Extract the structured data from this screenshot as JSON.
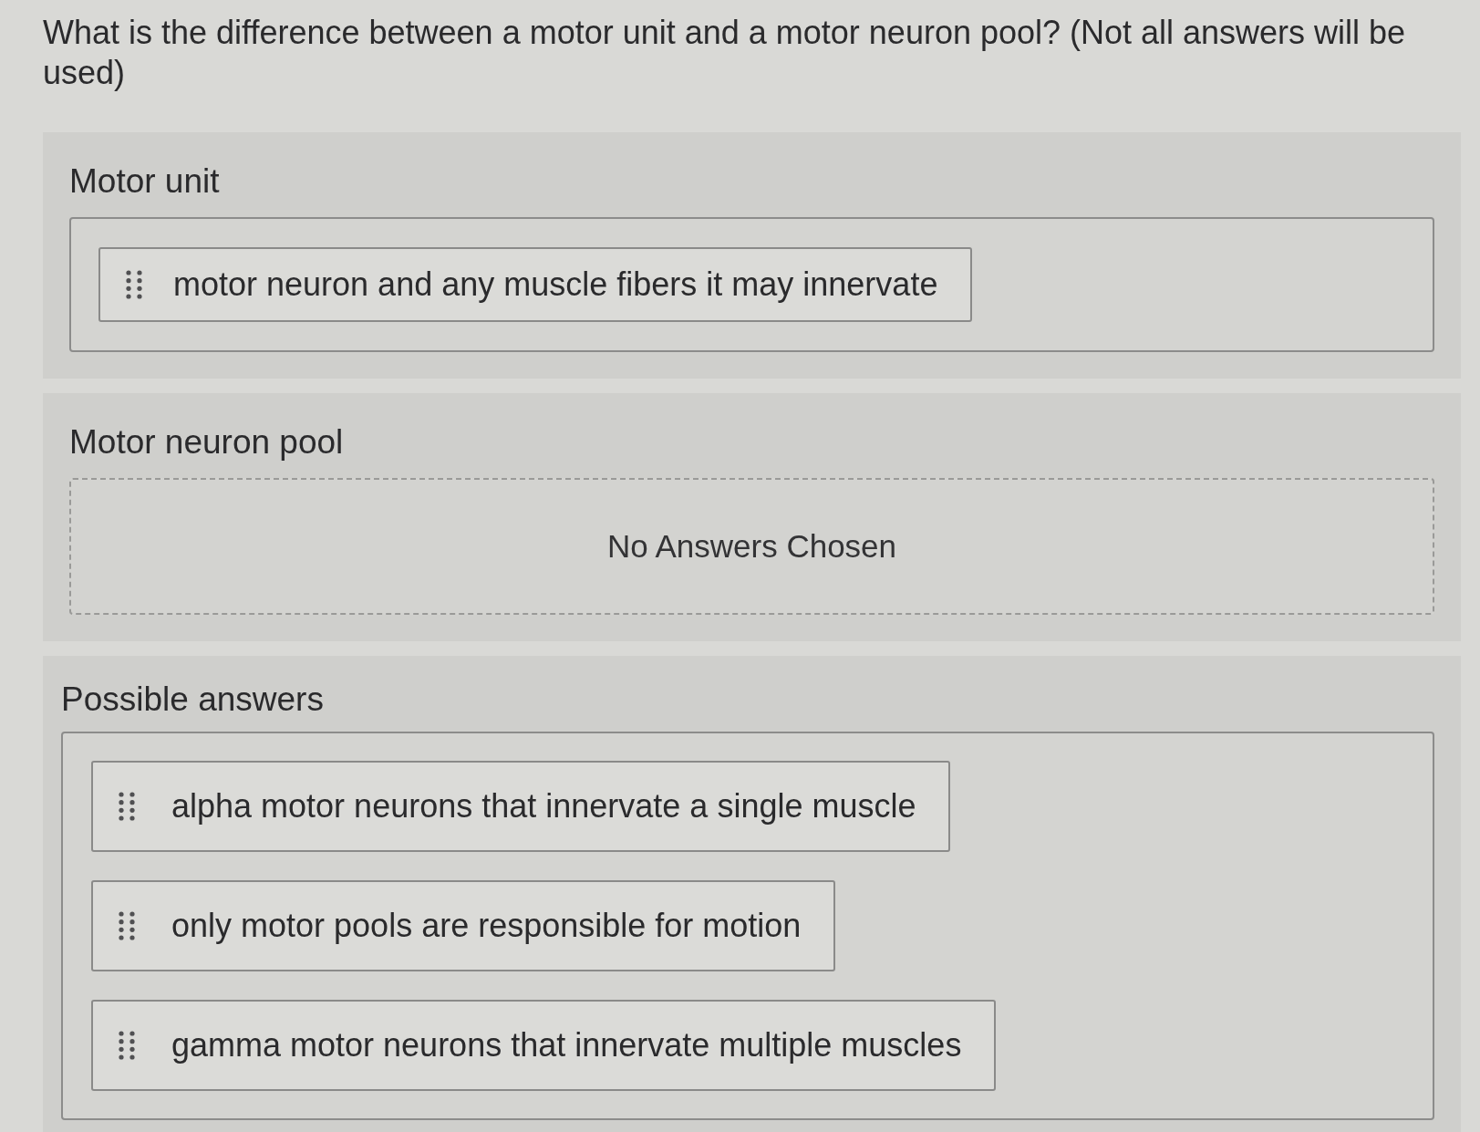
{
  "question": "What is the difference between a motor unit and a motor neuron pool? (Not all answers will be used)",
  "targets": [
    {
      "label": "Motor unit",
      "answers": [
        "motor neuron and any muscle fibers it may innervate"
      ]
    },
    {
      "label": "Motor neuron pool",
      "placeholder": "No Answers Chosen"
    }
  ],
  "answer_bank": {
    "label": "Possible answers",
    "answers": [
      "alpha motor neurons that innervate a single muscle",
      "only motor pools are responsible for motion",
      "gamma motor neurons that innervate multiple muscles"
    ]
  }
}
